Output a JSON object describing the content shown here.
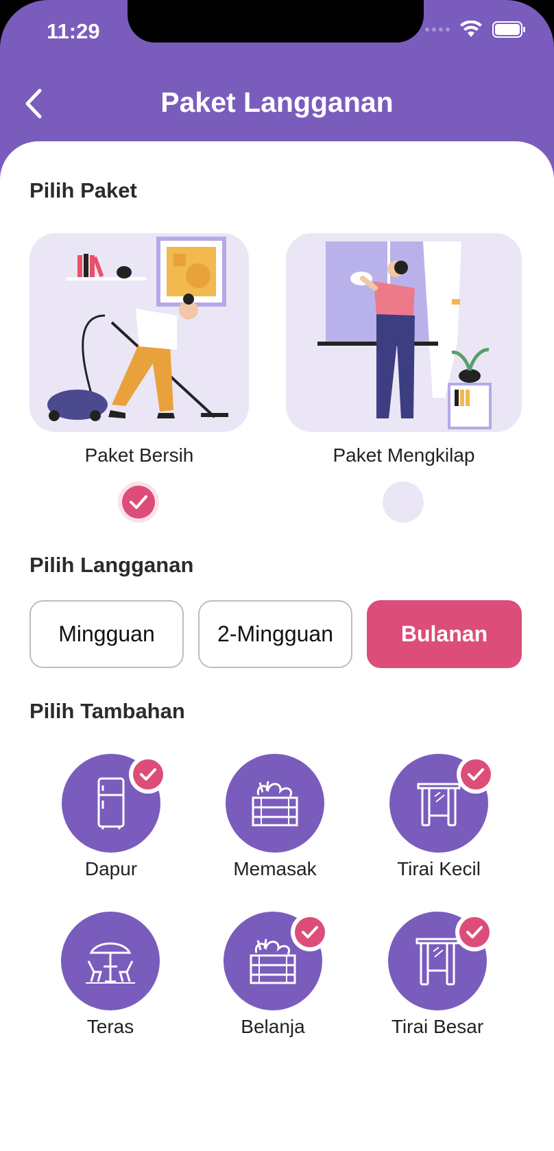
{
  "status_bar": {
    "time": "11:29"
  },
  "header": {
    "title": "Paket Langganan"
  },
  "sections": {
    "package": "Pilih Paket",
    "subscription": "Pilih Langganan",
    "addons": "Pilih Tambahan"
  },
  "packages": [
    {
      "label": "Paket Bersih",
      "selected": true
    },
    {
      "label": "Paket Mengkilap",
      "selected": false
    }
  ],
  "subscriptions": [
    {
      "label": "Mingguan",
      "active": false
    },
    {
      "label": "2-Mingguan",
      "active": false
    },
    {
      "label": "Bulanan",
      "active": true
    }
  ],
  "addons": [
    {
      "label": "Dapur",
      "icon": "fridge-icon",
      "checked": true
    },
    {
      "label": "Memasak",
      "icon": "vegetable-crate-icon",
      "checked": false
    },
    {
      "label": "Tirai Kecil",
      "icon": "small-window-icon",
      "checked": true
    },
    {
      "label": "Teras",
      "icon": "patio-umbrella-icon",
      "checked": false
    },
    {
      "label": "Belanja",
      "icon": "vegetable-crate-icon",
      "checked": true
    },
    {
      "label": "Tirai Besar",
      "icon": "large-window-icon",
      "checked": true
    }
  ],
  "colors": {
    "primary": "#7a5cbd",
    "accent": "#dc4d7a",
    "card_bg": "#ebe6f6"
  }
}
